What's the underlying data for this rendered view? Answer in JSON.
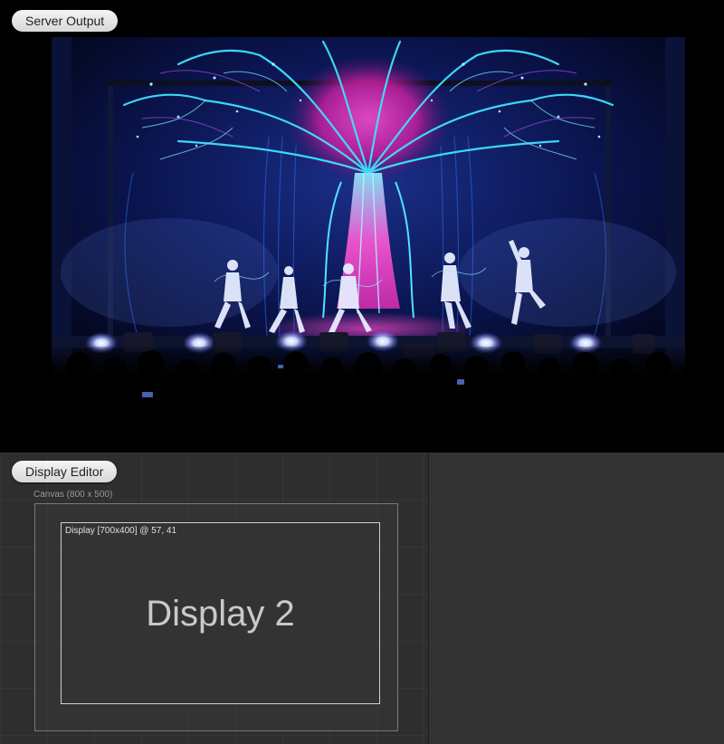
{
  "server_output": {
    "label": "Server Output"
  },
  "display_editor": {
    "label": "Display Editor",
    "canvas_label": "Canvas (800 x 500)",
    "display": {
      "info": "Display [700x400] @ 57, 41",
      "name": "Display 2"
    }
  },
  "colors": {
    "background": "#000000",
    "editor_background": "#2e2e2e",
    "editor_right_background": "#333333",
    "pill_background": "#e6e6e6",
    "stage_cyan": "#35d8ff",
    "stage_magenta": "#e02aa8",
    "stage_blue": "#1a2a7a"
  },
  "icons": {
    "stage_image": "stage-performance-image"
  }
}
